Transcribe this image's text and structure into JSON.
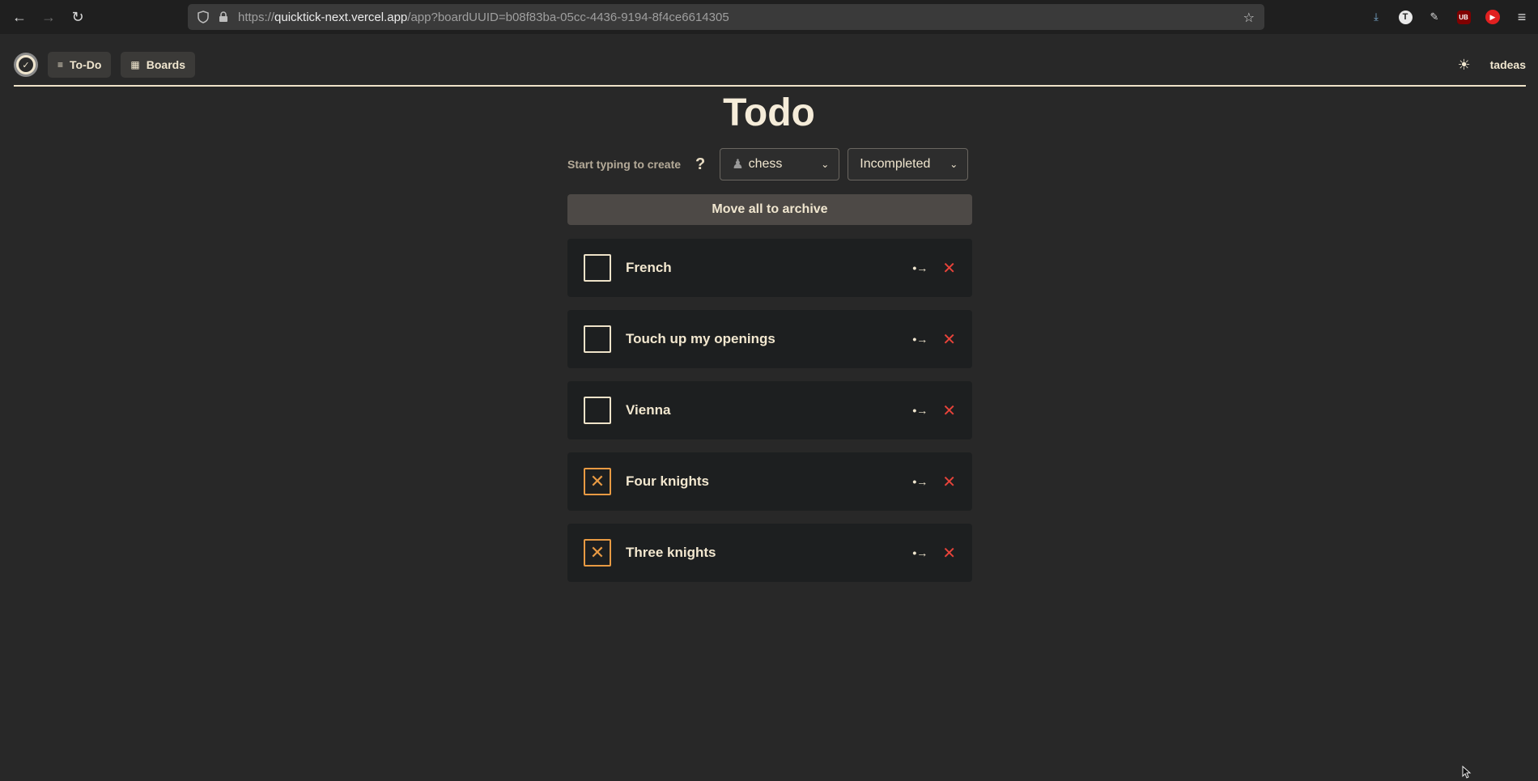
{
  "browser": {
    "url_prefix": "https://",
    "url_host": "quicktick-next.vercel.app",
    "url_path": "/app?boardUUID=b08f83ba-05cc-4436-9194-8f4ce6614305",
    "icons": [
      "back-icon",
      "forward-icon",
      "reload-icon",
      "shield-icon",
      "lock-icon",
      "star-icon",
      "download-icon",
      "translate-extension-icon",
      "extensions-icon",
      "ublock-icon",
      "youtube-icon",
      "menu-icon"
    ],
    "ext_t_label": "T",
    "ext_ub_label": "UB"
  },
  "header": {
    "todo_label": "To-Do",
    "boards_label": "Boards",
    "user_name": "tadeas"
  },
  "main": {
    "title": "Todo",
    "hint": "Start typing to create",
    "help": "?",
    "board_select": "chess",
    "filter_select": "Incompleted",
    "archive_button": "Move all to archive"
  },
  "items": [
    {
      "label": "French",
      "done": false
    },
    {
      "label": "Touch up my openings",
      "done": false
    },
    {
      "label": "Vienna",
      "done": false
    },
    {
      "label": "Four knights",
      "done": true
    },
    {
      "label": "Three knights",
      "done": true
    }
  ],
  "colors": {
    "background": "#282828",
    "accent_cream": "#efe3c9",
    "done_orange": "#e89a43",
    "delete_red": "#e8433a"
  }
}
